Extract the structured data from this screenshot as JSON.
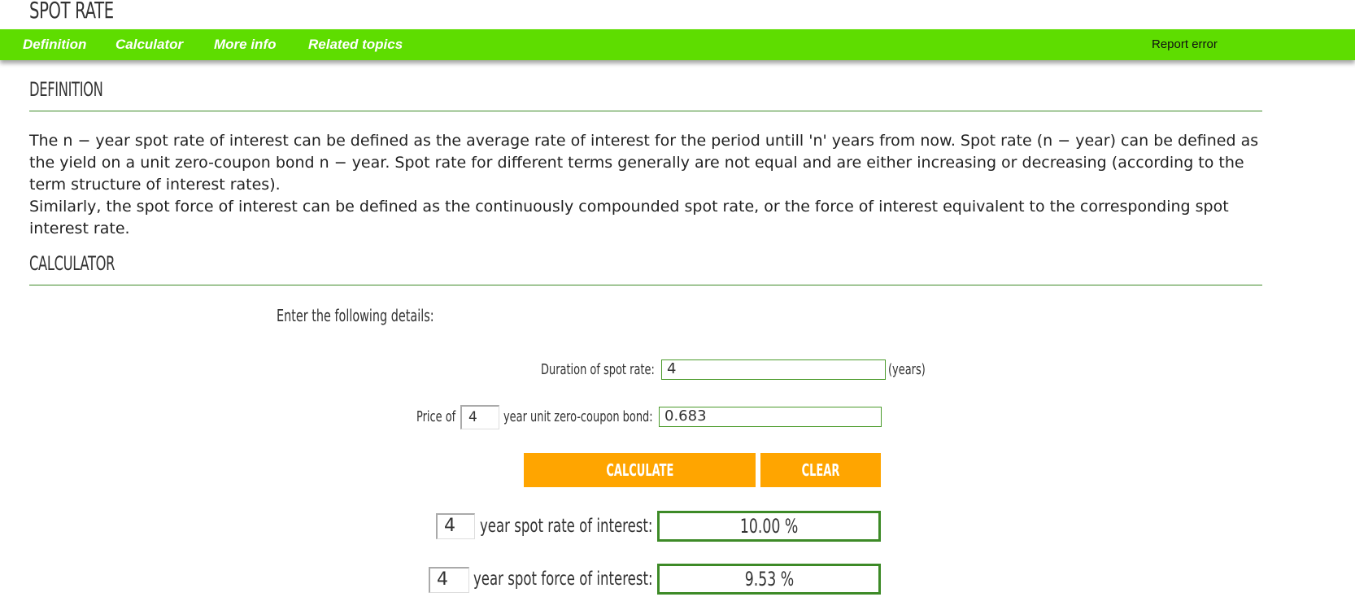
{
  "page": {
    "title": "SPOT RATE"
  },
  "nav": {
    "items": [
      "Definition",
      "Calculator",
      "More info",
      "Related topics"
    ],
    "report": "Report error"
  },
  "definition": {
    "heading": "DEFINITION",
    "para1": "The n − year spot rate of interest can be defined as the average rate of interest for the period untill 'n' years from now. Spot rate (n − year) can be defined as the yield on a unit zero-coupon bond n − year. Spot rate for different terms generally are not equal and are either increasing or decreasing (according to the term structure of interest rates).",
    "para2": "Similarly, the spot force of interest can be defined as the continuously compounded spot rate, or the force of interest equivalent to the corresponding spot interest rate."
  },
  "calculator": {
    "heading": "CALCULATOR",
    "intro": "Enter the following details:",
    "duration_label": "Duration of spot rate:",
    "duration_value": "4",
    "duration_unit": "(years)",
    "price_prefix": "Price of",
    "price_n": "4",
    "price_suffix": "year unit zero-coupon bond:",
    "price_value": "0.683",
    "calculate_label": "CALCULATE",
    "clear_label": "CLEAR",
    "spot_rate_n": "4",
    "spot_rate_label": "year spot rate of interest:",
    "spot_rate_value": "10.00 %",
    "spot_force_n": "4",
    "spot_force_label": "year spot force of interest:",
    "spot_force_value": "9.53 %"
  },
  "colors": {
    "nav_bg": "#5edd00",
    "accent_button": "#ffa500",
    "border_green": "#3d8a27"
  }
}
